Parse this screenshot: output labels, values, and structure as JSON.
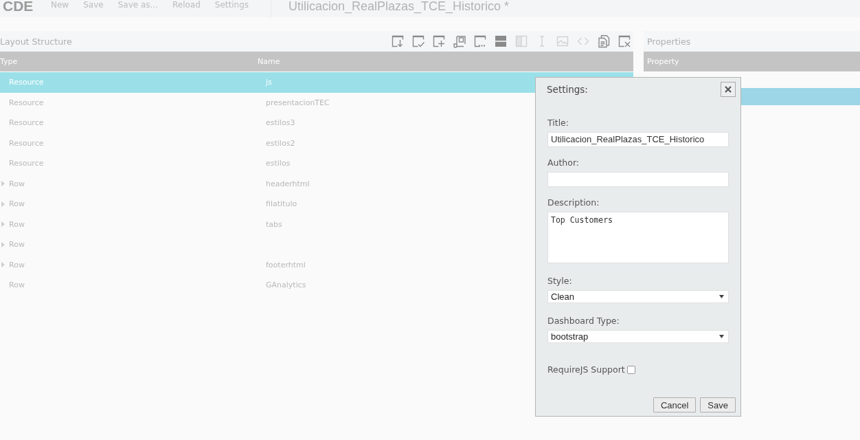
{
  "toolbar": {
    "logo": "CDE",
    "menu": [
      {
        "label": "New"
      },
      {
        "label": "Save"
      },
      {
        "label": "Save as..."
      },
      {
        "label": "Reload"
      },
      {
        "label": "Settings"
      }
    ],
    "title": "Utilicacion_RealPlazas_TCE_Historico *"
  },
  "layout_panel": {
    "title": "Layout Structure",
    "tools": [
      {
        "kind": "download",
        "disabled": false
      },
      {
        "kind": "check",
        "disabled": false
      },
      {
        "kind": "plus",
        "disabled": false
      },
      {
        "kind": "scroll",
        "disabled": false
      },
      {
        "kind": "dots",
        "disabled": false
      },
      {
        "kind": "rows",
        "disabled": false
      },
      {
        "kind": "columns",
        "disabled": true
      },
      {
        "kind": "text",
        "disabled": true
      },
      {
        "kind": "image",
        "disabled": true
      },
      {
        "kind": "code",
        "disabled": true
      },
      {
        "kind": "copy",
        "disabled": false
      },
      {
        "kind": "remove",
        "disabled": false
      }
    ],
    "columns": [
      "Type",
      "Name"
    ],
    "rows": [
      {
        "type": "Resource",
        "name": "js",
        "selected": true,
        "expandable": false
      },
      {
        "type": "Resource",
        "name": "presentacionTEC",
        "selected": false,
        "expandable": false
      },
      {
        "type": "Resource",
        "name": "estilos3",
        "selected": false,
        "expandable": false
      },
      {
        "type": "Resource",
        "name": "estilos2",
        "selected": false,
        "expandable": false
      },
      {
        "type": "Resource",
        "name": "estilos",
        "selected": false,
        "expandable": false
      },
      {
        "type": "Row",
        "name": "headerhtml",
        "selected": false,
        "expandable": true
      },
      {
        "type": "Row",
        "name": "filatitulo",
        "selected": false,
        "expandable": true
      },
      {
        "type": "Row",
        "name": "tabs",
        "selected": false,
        "expandable": true
      },
      {
        "type": "Row",
        "selected": false,
        "expandable": true
      },
      {
        "type": "Row",
        "name": "footerhtml",
        "selected": false,
        "expandable": true
      },
      {
        "type": "Row",
        "name": "GAnalytics",
        "selected": false,
        "expandable": false
      }
    ]
  },
  "properties_panel": {
    "title": "Properties",
    "columns": [
      "Property"
    ],
    "rows": [
      {
        "selected": true
      }
    ]
  },
  "settings_dialog": {
    "title": "Settings:",
    "fields": [
      {
        "kind": "text",
        "label": "Title:",
        "value": "Utilicacion_RealPlazas_TCE_Historico"
      },
      {
        "kind": "text",
        "label": "Author:"
      },
      {
        "kind": "textarea",
        "label": "Description:",
        "value": "Top Customers"
      },
      {
        "kind": "select",
        "label": "Style:",
        "value": "Clean"
      },
      {
        "kind": "select",
        "label": "Dashboard Type:",
        "value": "bootstrap"
      },
      {
        "kind": "checkbox",
        "label": "RequireJS Support",
        "checked": false
      }
    ],
    "buttons": [
      "Cancel",
      "Save"
    ]
  }
}
